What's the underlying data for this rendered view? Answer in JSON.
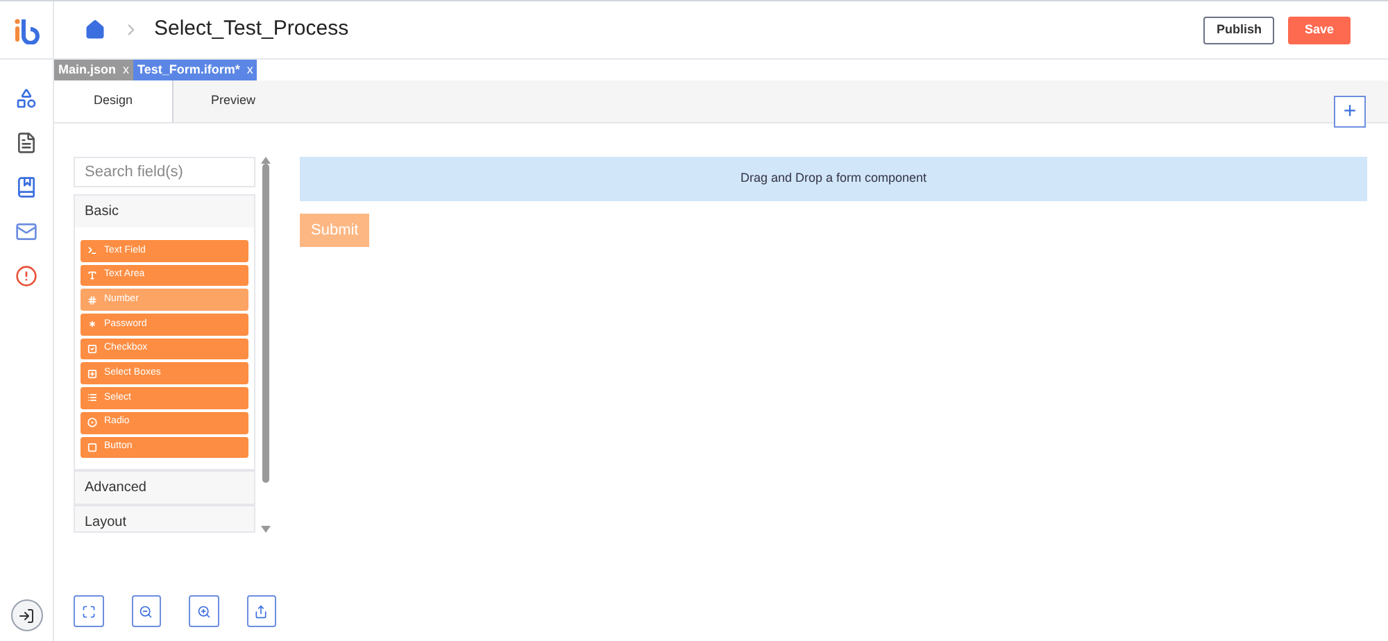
{
  "header": {
    "title": "Select_Test_Process",
    "buttons": [
      {
        "label": "Publish",
        "kind": "outline"
      },
      {
        "label": "Save",
        "kind": "primary"
      }
    ]
  },
  "file_tabs": [
    {
      "label": "Main.json",
      "close": "x",
      "selected": false
    },
    {
      "label": "Test_Form.iform*",
      "close": "x",
      "selected": true
    }
  ],
  "view_tabs": [
    {
      "label": "Design",
      "selected": true
    },
    {
      "label": "Preview",
      "selected": false
    }
  ],
  "add_button": "+",
  "palette": {
    "search": {
      "placeholder": "Search field(s)"
    },
    "groups": [
      {
        "label": "Basic",
        "expanded": true,
        "items": [
          {
            "label": "Text Field",
            "kind": "textfield",
            "hovered": false
          },
          {
            "label": "Text Area",
            "kind": "textarea",
            "hovered": false
          },
          {
            "label": "Number",
            "kind": "number",
            "hovered": true
          },
          {
            "label": "Password",
            "kind": "password",
            "hovered": false
          },
          {
            "label": "Checkbox",
            "kind": "checkbox",
            "hovered": false
          },
          {
            "label": "Select Boxes",
            "kind": "selectboxes",
            "hovered": false
          },
          {
            "label": "Select",
            "kind": "select",
            "hovered": false
          },
          {
            "label": "Radio",
            "kind": "radio",
            "hovered": false
          },
          {
            "label": "Button",
            "kind": "button",
            "hovered": false
          }
        ]
      },
      {
        "label": "Advanced",
        "expanded": false
      },
      {
        "label": "Layout",
        "expanded": false
      }
    ]
  },
  "canvas": {
    "dropzone": "Drag and Drop a form component",
    "submit": "Submit"
  }
}
